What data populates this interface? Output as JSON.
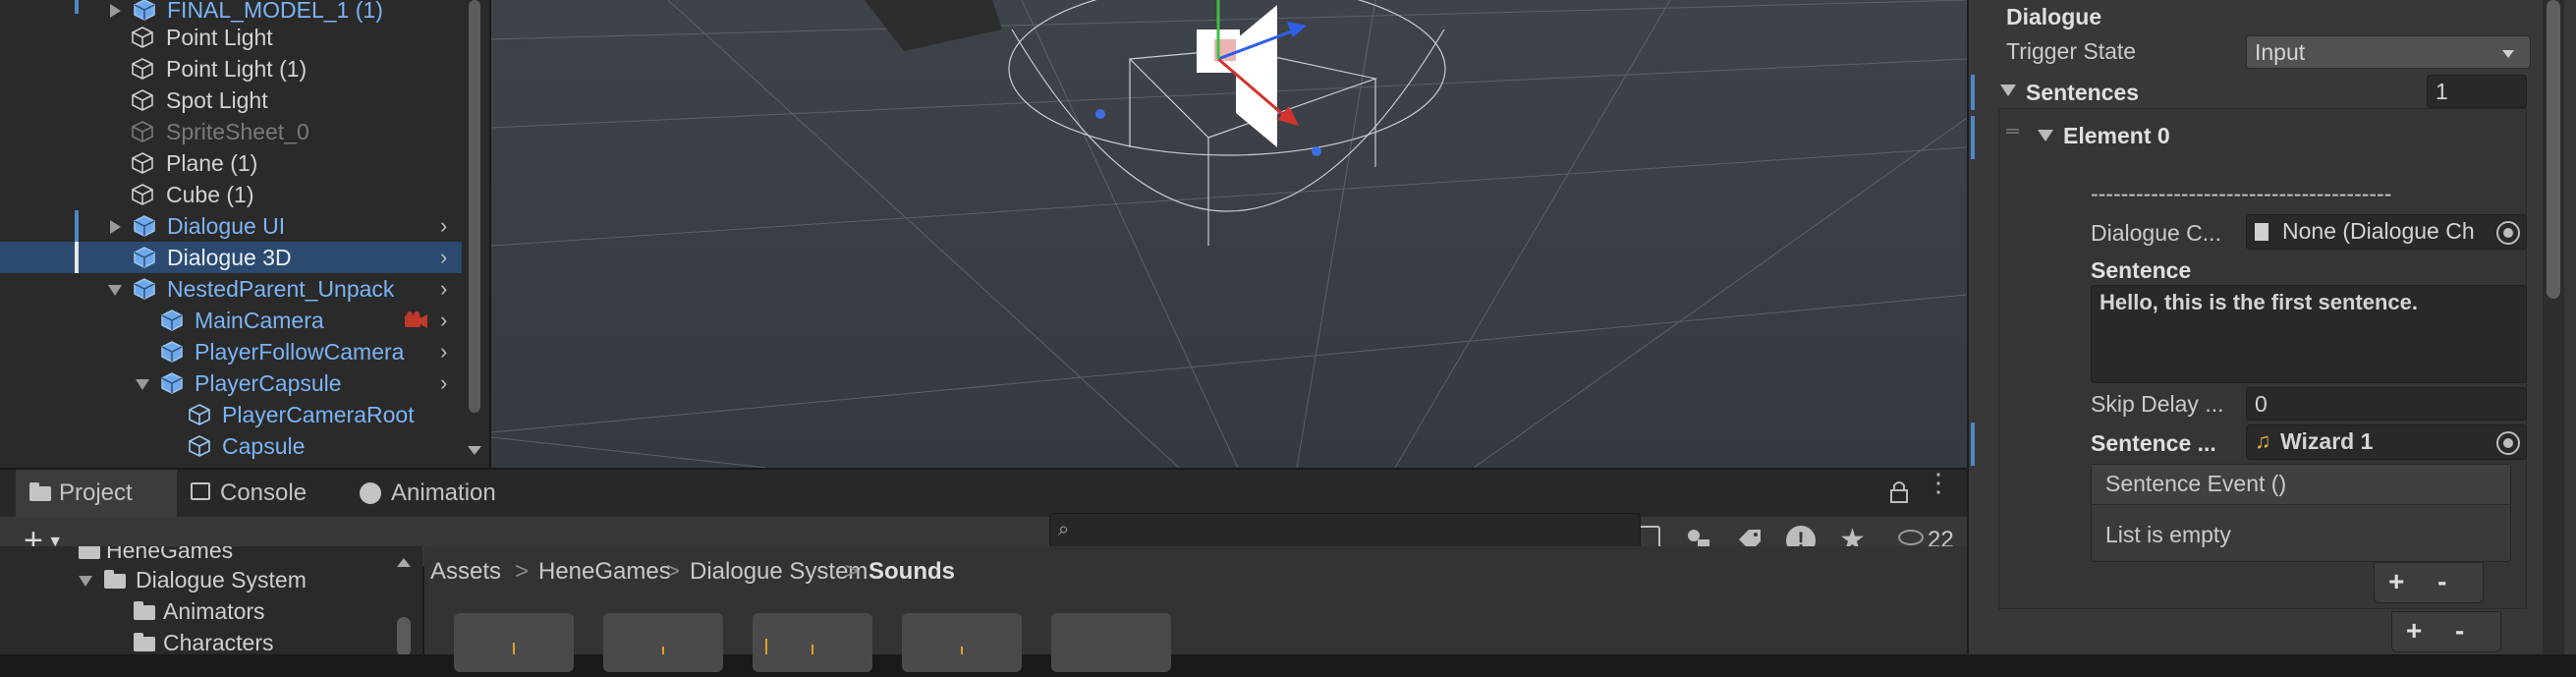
{
  "hierarchy": {
    "rows": [
      {
        "label": "FINAL_MODEL_1 (1)"
      },
      {
        "label": "Point Light"
      },
      {
        "label": "Point Light (1)"
      },
      {
        "label": "Spot Light"
      },
      {
        "label": "SpriteSheet_0"
      },
      {
        "label": "Plane (1)"
      },
      {
        "label": "Cube (1)"
      },
      {
        "label": "Dialogue UI"
      },
      {
        "label": "Dialogue 3D"
      },
      {
        "label": "NestedParent_Unpack"
      },
      {
        "label": "MainCamera"
      },
      {
        "label": "PlayerFollowCamera"
      },
      {
        "label": "PlayerCapsule"
      },
      {
        "label": "PlayerCameraRoot"
      },
      {
        "label": "Capsule"
      }
    ]
  },
  "bottom_tabs": [
    {
      "label": "Project"
    },
    {
      "label": "Console"
    },
    {
      "label": "Animation"
    }
  ],
  "project_toolbar": {
    "add_label": "+",
    "hidden_count": "22"
  },
  "folders": [
    {
      "label": "HeneGames"
    },
    {
      "label": "Dialogue System"
    },
    {
      "label": "Animators"
    },
    {
      "label": "Characters"
    }
  ],
  "breadcrumb": [
    "Assets",
    "HeneGames",
    "Dialogue System",
    "Sounds"
  ],
  "breadcrumb_separator": ">",
  "inspector": {
    "component_title": "Dialogue",
    "trigger_state_label": "Trigger State",
    "trigger_state_value": "Input",
    "sentences_label": "Sentences",
    "sentences_count": "1",
    "element_label": "Element 0",
    "divider_text": "----------------------------------------",
    "dialogue_character_label": "Dialogue C...",
    "dialogue_character_value": "None (Dialogue Ch",
    "sentence_label": "Sentence",
    "sentence_value": "Hello, this is the first sentence.",
    "skip_delay_label": "Skip Delay ...",
    "skip_delay_value": "0",
    "sentence_sound_label": "Sentence ...",
    "sentence_sound_value": "Wizard 1",
    "event_title": "Sentence Event ()",
    "event_empty": "List is empty",
    "plus": "+",
    "minus": "-"
  },
  "colors": {
    "selection": "#2c4a70",
    "prefab_blue": "#7cb4f4",
    "accent_bar": "#4f86c6"
  }
}
